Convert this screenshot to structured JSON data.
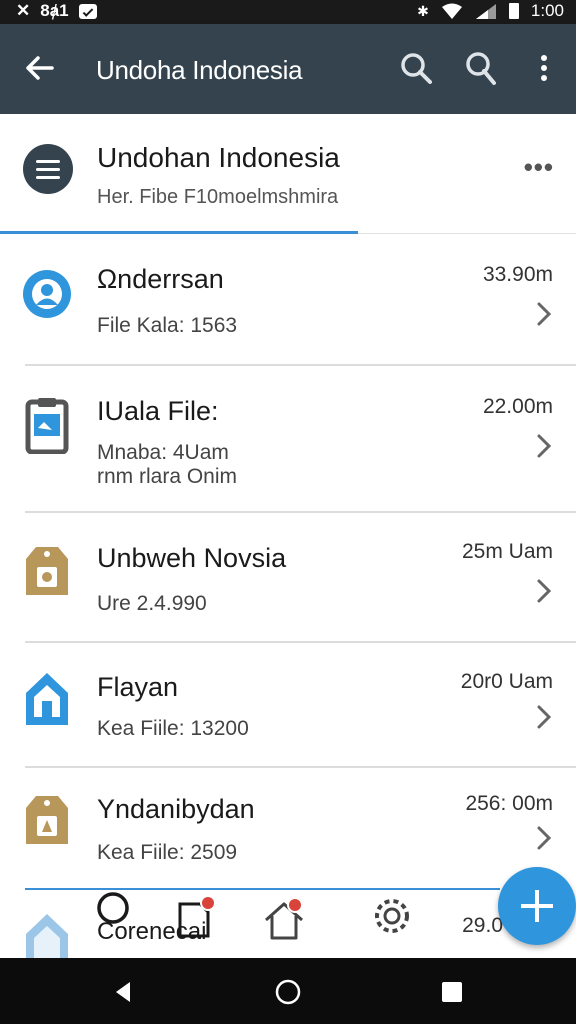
{
  "status_bar": {
    "left_text": "8ⱥ1",
    "time": "1:00",
    "icons": [
      "x-icon",
      "message-icon",
      "bluetooth-icon",
      "wifi-icon",
      "signal-icon",
      "battery-icon"
    ]
  },
  "app_bar": {
    "title": "Undoha Indonesia",
    "icons": [
      "back-arrow-icon",
      "search-icon",
      "search-icon",
      "overflow-menu-icon"
    ]
  },
  "header": {
    "title": "Undohan Indonesia",
    "subtitle": "Her. Fibe  F10moelmshmira",
    "more_label": "•••"
  },
  "list": [
    {
      "title": "Ωnderrsan",
      "subtitle": "File Kala: 1563",
      "meta": "33.90m",
      "icon": "user-circle-icon",
      "icon_color": "#2f95dc"
    },
    {
      "title": "IUala File:",
      "subtitle": "Mnaba: 4Uam",
      "subtitle2": "rnm rlara Onim",
      "meta": "22.00m",
      "icon": "clipboard-icon",
      "icon_color": "#555555"
    },
    {
      "title": "Unbweh Novsia",
      "subtitle": "Ure 2.4.990",
      "meta": "25m Uam",
      "icon": "tag-icon",
      "icon_color": "#b8975a"
    },
    {
      "title": "Flayan",
      "subtitle": "Kea Fiile: 13200",
      "meta": "20r0 Uam",
      "icon": "home-icon",
      "icon_color": "#2f95dc"
    },
    {
      "title": "Yndanibydan",
      "subtitle": "Kea Fiile: 2509",
      "meta": "256: 00m",
      "icon": "tag-icon",
      "icon_color": "#b8975a"
    }
  ],
  "partial_item": {
    "title": "Corenecai",
    "meta": "29.0"
  },
  "bottom_nav": {
    "icons": [
      "search-icon",
      "file-badge-icon",
      "home-badge-icon",
      "settings-gear-icon"
    ]
  },
  "fab": {
    "icon": "plus-icon"
  },
  "system_nav": {
    "icons": [
      "back-triangle-icon",
      "home-circle-icon",
      "recents-square-icon"
    ]
  },
  "colors": {
    "app_bar": "#34434e",
    "accent": "#2f95dc",
    "badge": "#d9443a",
    "tag": "#b8975a"
  }
}
